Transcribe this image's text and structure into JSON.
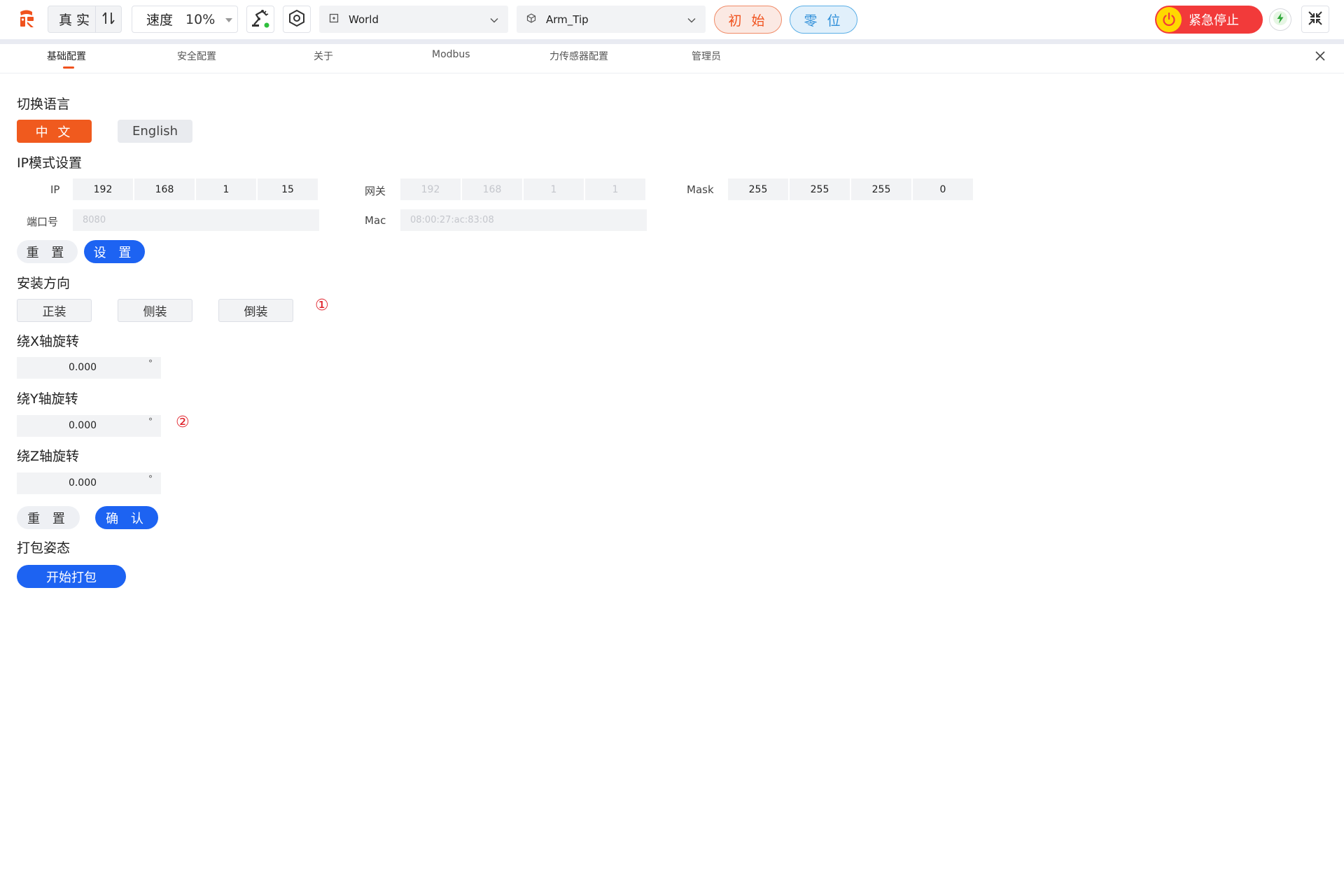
{
  "toolbar": {
    "mode_label": "真 实",
    "speed_label": "速度",
    "speed_value": "10%",
    "coord_select": "World",
    "tool_select": "Arm_Tip",
    "init_button": "初 始",
    "zero_button": "零 位",
    "estop_button": "紧急停止",
    "colors": {
      "accent_orange": "#f0521e",
      "blue": "#1d63f2",
      "estop_red": "#f23a3a",
      "estop_yellow": "#ffd800"
    }
  },
  "tabs": [
    {
      "label": "基础配置",
      "active": true
    },
    {
      "label": "安全配置"
    },
    {
      "label": "关于"
    },
    {
      "label": "Modbus"
    },
    {
      "label": "力传感器配置"
    },
    {
      "label": "管理员"
    }
  ],
  "language": {
    "title": "切换语言",
    "zh_button": "中 文",
    "en_button": "English"
  },
  "ip": {
    "title": "IP模式设置",
    "ip_label": "IP",
    "ip": [
      "192",
      "168",
      "1",
      "15"
    ],
    "gateway_label": "网关",
    "gateway": [
      "192",
      "168",
      "1",
      "1"
    ],
    "mask_label": "Mask",
    "mask": [
      "255",
      "255",
      "255",
      "0"
    ],
    "port_label": "端口号",
    "port_placeholder": "8080",
    "mac_label": "Mac",
    "mac_placeholder": "08:00:27:ac:83:08",
    "reset_button": "重 置",
    "set_button": "设 置"
  },
  "mount": {
    "title": "安装方向",
    "options": [
      "正装",
      "侧装",
      "倒装"
    ],
    "marker": "①"
  },
  "rotation": {
    "x_title": "绕X轴旋转",
    "x_value": "0.000",
    "y_title": "绕Y轴旋转",
    "y_value": "0.000",
    "z_title": "绕Z轴旋转",
    "z_value": "0.000",
    "unit": "°",
    "marker": "②",
    "reset_button": "重 置",
    "confirm_button": "确 认"
  },
  "pack": {
    "title": "打包姿态",
    "start_button": "开始打包"
  }
}
